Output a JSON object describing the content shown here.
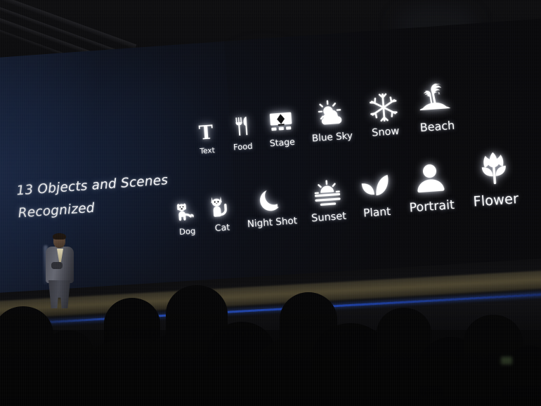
{
  "scene": {
    "type": "keynote-presentation-photo",
    "venue": "dark-auditorium",
    "screen_background_color": "#0a0d16",
    "screen_glow_color": "#16223c",
    "stage_edge_amber_color": "#605638",
    "stage_led_blue_color": "#2856d2",
    "icon_color": "#fafbfc"
  },
  "slide": {
    "headline_line1": "13 Objects and Scenes",
    "headline_line2": "Recognized",
    "row1": [
      {
        "label": "Text",
        "icon": "text-serif-t-icon",
        "icon_size": 30,
        "font_size": 10.5
      },
      {
        "label": "Food",
        "icon": "fork-knife-icon",
        "icon_size": 32,
        "font_size": 11.5
      },
      {
        "label": "Stage",
        "icon": "stage-spotlight-icon",
        "icon_size": 35,
        "font_size": 12.5
      },
      {
        "label": "Blue Sky",
        "icon": "sun-behind-cloud-icon",
        "icon_size": 38,
        "font_size": 13.5
      },
      {
        "label": "Snow",
        "icon": "snowflake-icon",
        "icon_size": 41,
        "font_size": 14.5
      },
      {
        "label": "Beach",
        "icon": "palm-island-icon",
        "icon_size": 45,
        "font_size": 16
      }
    ],
    "row2": [
      {
        "label": "Dog",
        "icon": "dog-icon",
        "icon_size": 33,
        "font_size": 11.5
      },
      {
        "label": "Cat",
        "icon": "cat-icon",
        "icon_size": 35,
        "font_size": 12.5
      },
      {
        "label": "Night Shot",
        "icon": "crescent-moon-icon",
        "icon_size": 37,
        "font_size": 13.5
      },
      {
        "label": "Sunset",
        "icon": "sunset-icon",
        "icon_size": 40,
        "font_size": 14.5
      },
      {
        "label": "Plant",
        "icon": "two-leaves-icon",
        "icon_size": 43,
        "font_size": 15.5
      },
      {
        "label": "Portrait",
        "icon": "person-bust-icon",
        "icon_size": 47,
        "font_size": 17.5
      },
      {
        "label": "Flower",
        "icon": "tulip-icon",
        "icon_size": 52,
        "font_size": 19.5
      }
    ]
  },
  "presenter": {
    "description": "speaker-in-grey-suit"
  },
  "audience": {
    "description": "audience-silhouettes"
  }
}
